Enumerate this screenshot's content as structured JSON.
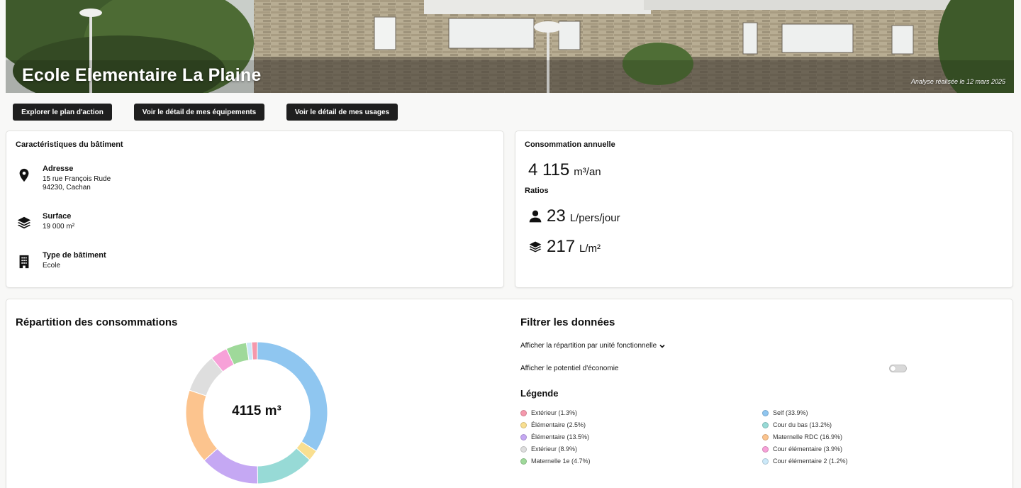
{
  "header": {
    "title": "Ecole Elementaire La Plaine",
    "analysis_date": "Analyse réalisée le 12 mars 2025"
  },
  "actions": {
    "plan": "Explorer le plan d'action",
    "equipments": "Voir le détail de mes équipements",
    "usages": "Voir le détail de mes usages"
  },
  "building": {
    "title": "Caractéristiques du bâtiment",
    "address_label": "Adresse",
    "address_line1": "15 rue François Rude",
    "address_line2": "94230, Cachan",
    "surface_label": "Surface",
    "surface_value": "19 000 m²",
    "type_label": "Type de bâtiment",
    "type_value": "Ecole"
  },
  "consumption": {
    "title": "Consommation annuelle",
    "annual_value": "4 115",
    "annual_unit": "m³/an",
    "ratios_label": "Ratios",
    "per_person_value": "23",
    "per_person_unit": "L/pers/jour",
    "per_surface_value": "217",
    "per_surface_unit": "L/m²"
  },
  "distribution": {
    "title": "Répartition des consommations",
    "total": "4115 m³"
  },
  "filters": {
    "title": "Filtrer les données",
    "select_label": "Afficher la répartition par unité fonctionnelle",
    "toggle_label": "Afficher le potentiel d'économie",
    "toggle_on": false,
    "legend_title": "Légende"
  },
  "colors": {
    "dark_button": "#1f1f1f",
    "card_border": "#e2e2e0"
  },
  "chart_data": {
    "type": "pie",
    "title": "",
    "total_label": "4115 m³",
    "slices": [
      {
        "label": "Self (33.9%)",
        "value": 33.9,
        "color": "#8fc6f0"
      },
      {
        "label": "Élémentaire (2.5%)",
        "value": 2.5,
        "color": "#f9df90"
      },
      {
        "label": "Cour du bas (13.2%)",
        "value": 13.2,
        "color": "#97dad6"
      },
      {
        "label": "Élémentaire (13.5%)",
        "value": 13.5,
        "color": "#c5a8f3"
      },
      {
        "label": "Maternelle RDC (16.9%)",
        "value": 16.9,
        "color": "#fcc48e"
      },
      {
        "label": "Extérieur (8.9%)",
        "value": 8.9,
        "color": "#dedede"
      },
      {
        "label": "Cour élémentaire (3.9%)",
        "value": 3.9,
        "color": "#f7a1d8"
      },
      {
        "label": "Maternelle 1e (4.7%)",
        "value": 4.7,
        "color": "#9fd99a"
      },
      {
        "label": "Cour élémentaire 2 (1.2%)",
        "value": 1.2,
        "color": "#cce9f9"
      },
      {
        "label": "Extérieur (1.3%)",
        "value": 1.3,
        "color": "#f598ac"
      }
    ],
    "legend_left": [
      {
        "label": "Extérieur (1.3%)",
        "color": "#f598ac"
      },
      {
        "label": "Élémentaire (2.5%)",
        "color": "#f9df90"
      },
      {
        "label": "Élémentaire (13.5%)",
        "color": "#c5a8f3"
      },
      {
        "label": "Extérieur (8.9%)",
        "color": "#dedede"
      },
      {
        "label": "Maternelle 1e (4.7%)",
        "color": "#9fd99a"
      }
    ],
    "legend_right": [
      {
        "label": "Self (33.9%)",
        "color": "#8fc6f0"
      },
      {
        "label": "Cour du bas (13.2%)",
        "color": "#97dad6"
      },
      {
        "label": "Maternelle RDC (16.9%)",
        "color": "#fcc48e"
      },
      {
        "label": "Cour élémentaire (3.9%)",
        "color": "#f7a1d8"
      },
      {
        "label": "Cour élémentaire 2 (1.2%)",
        "color": "#cce9f9"
      }
    ]
  }
}
